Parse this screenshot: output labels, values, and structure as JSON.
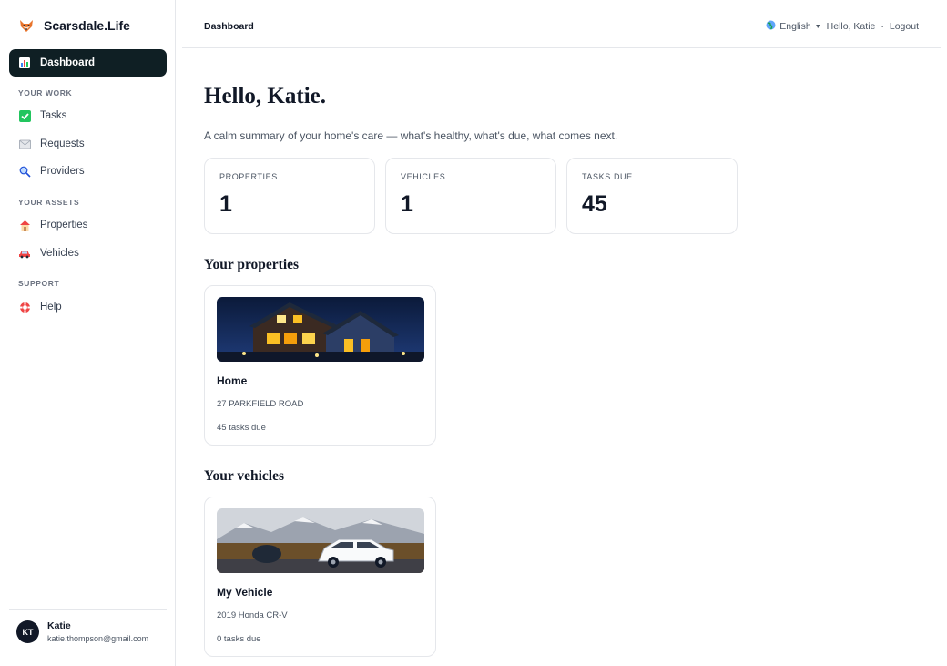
{
  "brand": {
    "name": "Scarsdale.Life",
    "logo_icon": "fox-icon"
  },
  "sidebar": {
    "items": [
      {
        "label": "Dashboard",
        "icon": "chart-icon",
        "active": true
      },
      {
        "label": "Tasks",
        "icon": "checkmark-icon"
      },
      {
        "label": "Requests",
        "icon": "envelope-icon"
      },
      {
        "label": "Providers",
        "icon": "magnifier-icon"
      },
      {
        "label": "Properties",
        "icon": "house-icon"
      },
      {
        "label": "Vehicles",
        "icon": "car-icon"
      },
      {
        "label": "Help",
        "icon": "lifebuoy-icon"
      }
    ],
    "sections": [
      "YOUR WORK",
      "YOUR ASSETS",
      "SUPPORT"
    ]
  },
  "user": {
    "initials": "KT",
    "name": "Katie",
    "email": "katie.thompson@gmail.com"
  },
  "header": {
    "breadcrumb": "Dashboard",
    "language": "English",
    "greeting": "Hello, Katie",
    "separator": "·",
    "logout": "Logout"
  },
  "main": {
    "title": "Hello, Katie.",
    "summary": "A calm summary of your home's care — what's healthy, what's due, what comes next.",
    "stats": [
      {
        "label": "PROPERTIES",
        "value": "1"
      },
      {
        "label": "VEHICLES",
        "value": "1"
      },
      {
        "label": "TASKS DUE",
        "value": "45"
      }
    ],
    "properties_title": "Your properties",
    "property": {
      "name": "Home",
      "address": "27 PARKFIELD ROAD",
      "due": "45 tasks due"
    },
    "vehicles_title": "Your vehicles",
    "vehicle": {
      "name": "My Vehicle",
      "model": "2019 Honda CR-V",
      "due": "0 tasks due"
    }
  },
  "colors": {
    "active_nav": "#0f1f24",
    "border": "#e5e7eb",
    "text": "#111827",
    "muted": "#4b5563"
  }
}
